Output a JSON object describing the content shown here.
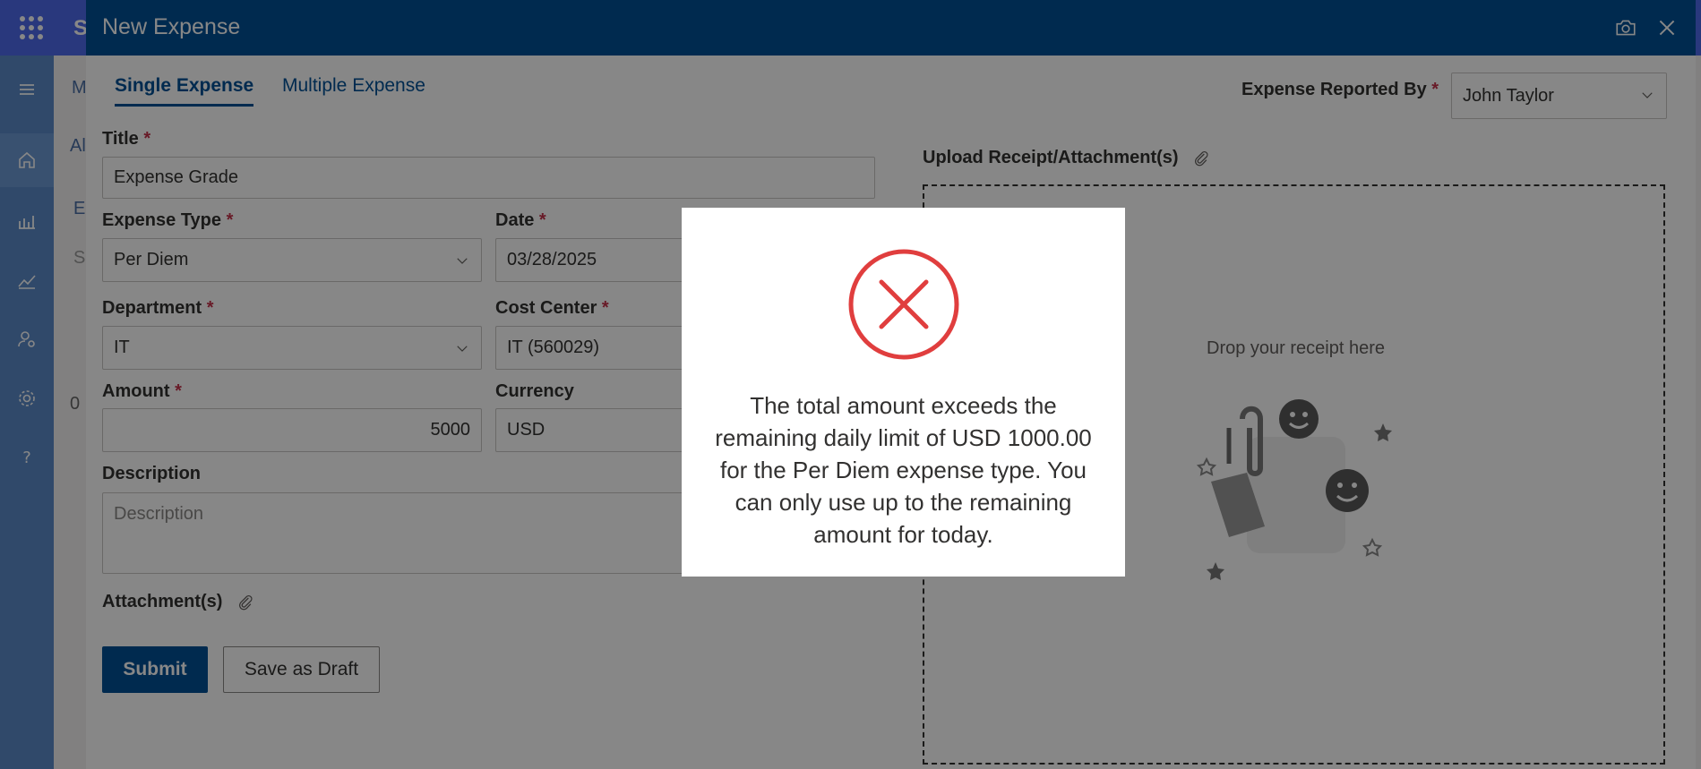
{
  "app": {
    "title_fragment": "S",
    "bg_texts": [
      "M",
      "Al",
      "E",
      "S",
      "0"
    ]
  },
  "rail": {
    "items": [
      "menu-icon",
      "home-icon",
      "analytics-icon",
      "trend-icon",
      "user-settings-icon",
      "settings-icon",
      "help-icon"
    ]
  },
  "panel": {
    "title": "New Expense",
    "tabs": [
      {
        "label": "Single Expense",
        "active": true
      },
      {
        "label": "Multiple Expense",
        "active": false
      }
    ],
    "reported_by": {
      "label": "Expense Reported By",
      "value": "John Taylor"
    },
    "form": {
      "title": {
        "label": "Title",
        "value": "Expense Grade"
      },
      "expense_type": {
        "label": "Expense Type",
        "value": "Per Diem"
      },
      "date": {
        "label": "Date",
        "value": "03/28/2025"
      },
      "department": {
        "label": "Department",
        "value": "IT"
      },
      "cost_center": {
        "label": "Cost Center",
        "value": "IT (560029)"
      },
      "amount": {
        "label": "Amount",
        "value": "5000"
      },
      "currency": {
        "label": "Currency",
        "value": "USD"
      },
      "description": {
        "label": "Description",
        "placeholder": "Description"
      },
      "attachments_label": "Attachment(s)",
      "required_mark": "*"
    },
    "upload": {
      "label": "Upload Receipt/Attachment(s)",
      "drop_text": "Drop your receipt here"
    },
    "buttons": {
      "submit": "Submit",
      "save_draft": "Save as Draft"
    }
  },
  "dialog": {
    "icon": "error-x-circle-icon",
    "message": "The total amount exceeds the remaining daily limit of USD 1000.00 for the Per Diem expense type. You can only use up to the remaining amount for today."
  },
  "colors": {
    "header": "#005096",
    "accent": "#005096",
    "error": "#e03e3e",
    "app_bar": "#4f6bed"
  }
}
